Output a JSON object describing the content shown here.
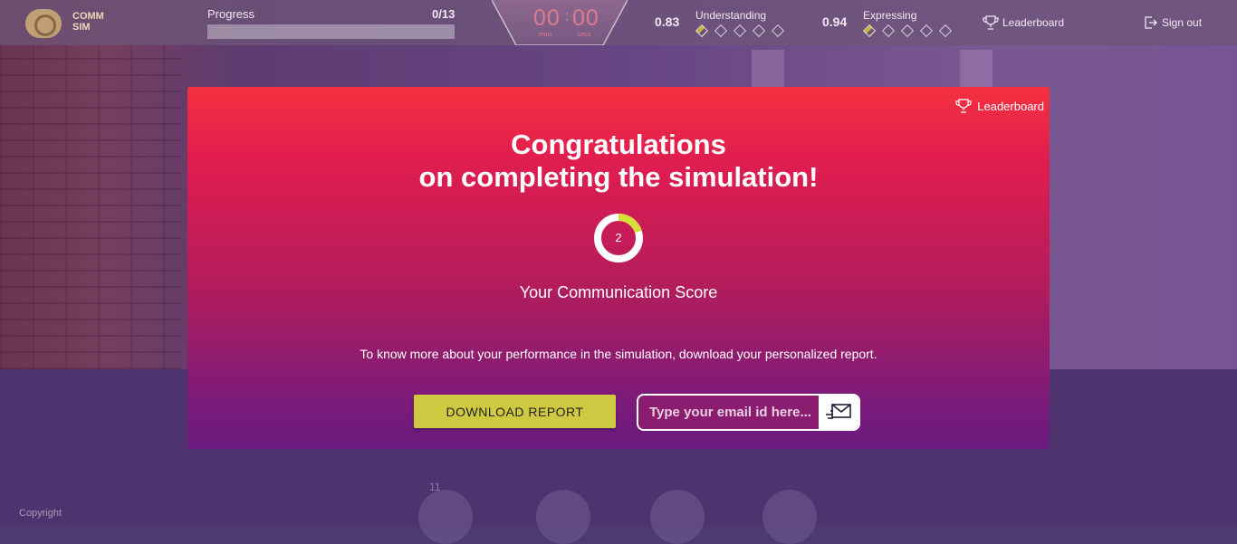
{
  "app": {
    "logo_line1": "COMM",
    "logo_line2": "SIM"
  },
  "progress": {
    "label": "Progress",
    "count": "0/13",
    "fraction": 0.0
  },
  "timer": {
    "mins": "00",
    "secs": "00",
    "mins_label": "mins",
    "secs_label": "secs"
  },
  "understanding": {
    "score": "0.83",
    "label": "Understanding",
    "level": 0.5,
    "max": 5
  },
  "expressing": {
    "score": "0.94",
    "label": "Expressing",
    "level": 0.5,
    "max": 5
  },
  "topbar": {
    "leaderboard": "Leaderboard",
    "signout": "Sign out"
  },
  "modal": {
    "leaderboard": "Leaderboard",
    "title_line1": "Congratulations",
    "title_line2": "on completing the simulation!",
    "score": "2",
    "score_fraction": 0.2,
    "score_caption": "Your Communication Score",
    "report_text": "To know more about your performance in the simulation, download your personalized report.",
    "download_label": "DOWNLOAD REPORT",
    "email_placeholder": "Type your email id here..."
  },
  "footer": {
    "copyright": "Copyright",
    "counter": "11"
  },
  "colors": {
    "accent": "#cfc841",
    "ring": "#d6e03a",
    "modal_top": "#f4313f",
    "modal_bottom": "#6a1b80"
  }
}
